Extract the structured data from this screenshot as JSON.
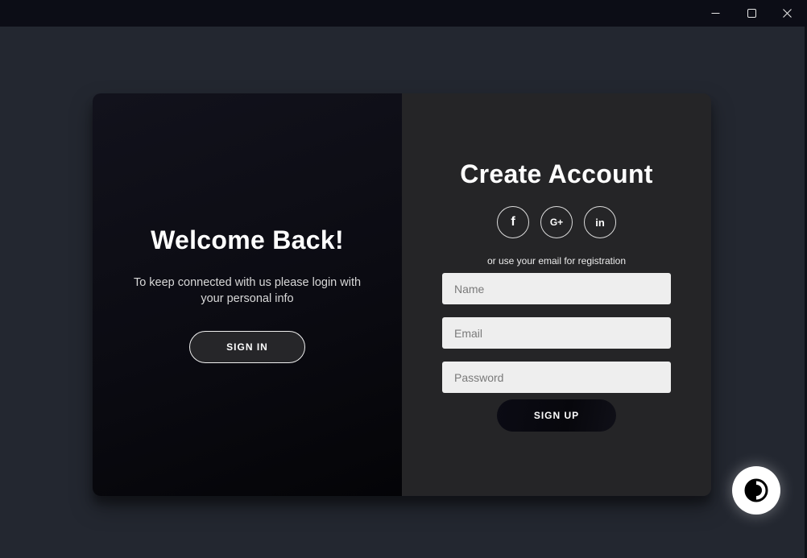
{
  "window": {
    "controls": {
      "minimize_icon": "minimize-icon",
      "maximize_icon": "maximize-icon",
      "close_icon": "close-icon"
    }
  },
  "overlay": {
    "title": "Welcome Back!",
    "text": "To keep connected with us please login with your personal info",
    "signin_label": "SIGN IN"
  },
  "signup": {
    "title": "Create Account",
    "social": [
      {
        "icon": "facebook-icon",
        "glyph": "f"
      },
      {
        "icon": "google-plus-icon",
        "glyph": "G+"
      },
      {
        "icon": "linkedin-icon",
        "glyph": "in"
      }
    ],
    "or_text": "or use your email for registration",
    "name_placeholder": "Name",
    "email_placeholder": "Email",
    "password_placeholder": "Password",
    "signup_label": "SIGN UP"
  },
  "theme_toggle": {
    "icon": "contrast-icon"
  },
  "colors": {
    "background": "#232730",
    "titlebar": "#0c0d16",
    "left_panel": "#0b0b12",
    "right_panel": "#252527",
    "input_bg": "#eeeeee"
  }
}
